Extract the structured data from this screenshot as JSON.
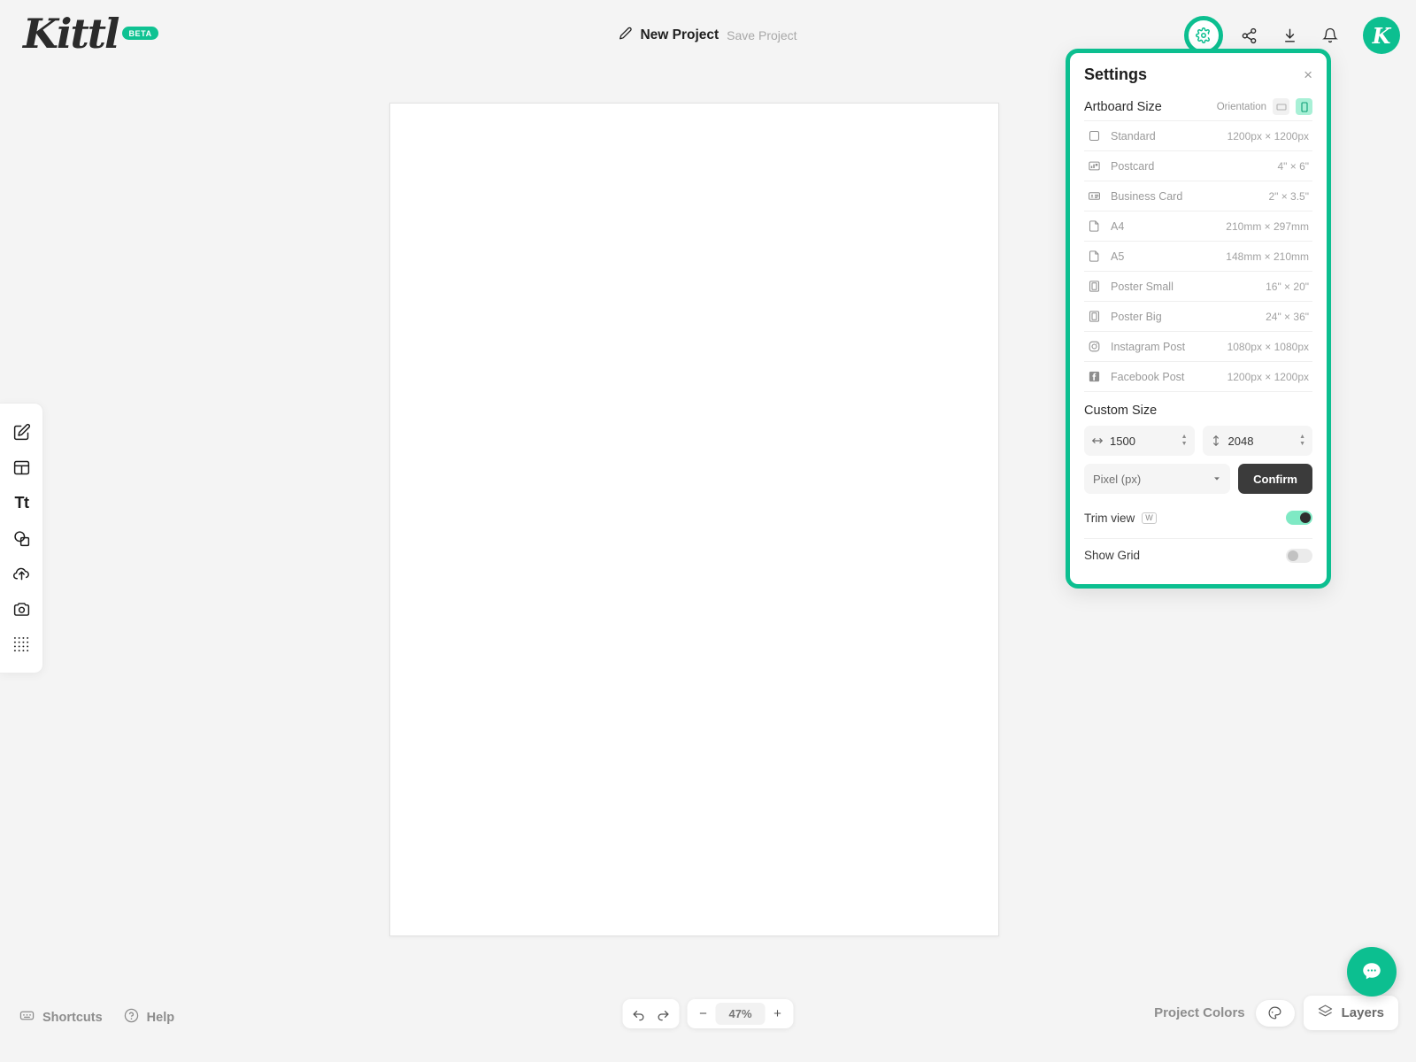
{
  "app": {
    "logo_text": "Kittl",
    "logo_badge": "BETA",
    "accent_color": "#0cbf90",
    "avatar_initial": "K"
  },
  "header": {
    "project_name": "New Project",
    "save_label": "Save Project",
    "icons": [
      {
        "name": "gear-icon",
        "highlighted": true
      },
      {
        "name": "share-icon",
        "highlighted": false
      },
      {
        "name": "download-icon",
        "highlighted": false
      },
      {
        "name": "bell-icon",
        "highlighted": false
      }
    ]
  },
  "left_toolbar": {
    "items": [
      {
        "name": "design-edit-tool",
        "icon": "pen-square-icon",
        "label": ""
      },
      {
        "name": "templates-tool",
        "icon": "templates-icon",
        "label": ""
      },
      {
        "name": "text-tool",
        "icon": "text-icon",
        "label": "Tt"
      },
      {
        "name": "shapes-tool",
        "icon": "shapes-icon",
        "label": ""
      },
      {
        "name": "uploads-tool",
        "icon": "upload-cloud-icon",
        "label": ""
      },
      {
        "name": "photos-tool",
        "icon": "camera-icon",
        "label": ""
      },
      {
        "name": "elements-tool",
        "icon": "dot-grid-icon",
        "label": ""
      }
    ]
  },
  "settings": {
    "title": "Settings",
    "close_label": "×",
    "artboard_section_title": "Artboard Size",
    "orientation_label": "Orientation",
    "orientation_options": [
      {
        "name": "landscape",
        "active": false
      },
      {
        "name": "portrait",
        "active": true
      }
    ],
    "sizes": [
      {
        "icon": "square-icon",
        "name": "Standard",
        "dimensions": "1200px × 1200px"
      },
      {
        "icon": "postcard-icon",
        "name": "Postcard",
        "dimensions": "4\" × 6\""
      },
      {
        "icon": "business-card-icon",
        "name": "Business Card",
        "dimensions": "2\" × 3.5\""
      },
      {
        "icon": "page-icon",
        "name": "A4",
        "dimensions": "210mm × 297mm"
      },
      {
        "icon": "page-icon",
        "name": "A5",
        "dimensions": "148mm × 210mm"
      },
      {
        "icon": "poster-icon",
        "name": "Poster Small",
        "dimensions": "16\" × 20\""
      },
      {
        "icon": "poster-icon",
        "name": "Poster Big",
        "dimensions": "24\" × 36\""
      },
      {
        "icon": "instagram-icon",
        "name": "Instagram Post",
        "dimensions": "1080px × 1080px"
      },
      {
        "icon": "facebook-icon",
        "name": "Facebook Post",
        "dimensions": "1200px × 1200px"
      }
    ],
    "custom_size": {
      "title": "Custom Size",
      "width_value": "1500",
      "height_value": "2048",
      "unit_value": "Pixel (px)",
      "confirm_label": "Confirm"
    },
    "toggles": [
      {
        "name": "trim-view",
        "label": "Trim view",
        "shortcut": "W",
        "state": "on"
      },
      {
        "name": "show-grid",
        "label": "Show Grid",
        "shortcut": "",
        "state": "off"
      }
    ]
  },
  "bottom_bar": {
    "shortcuts_label": "Shortcuts",
    "help_label": "Help",
    "zoom_value": "47%",
    "zoom_out_label": "−",
    "zoom_in_label": "+",
    "project_colors_label": "Project Colors",
    "layers_label": "Layers"
  }
}
